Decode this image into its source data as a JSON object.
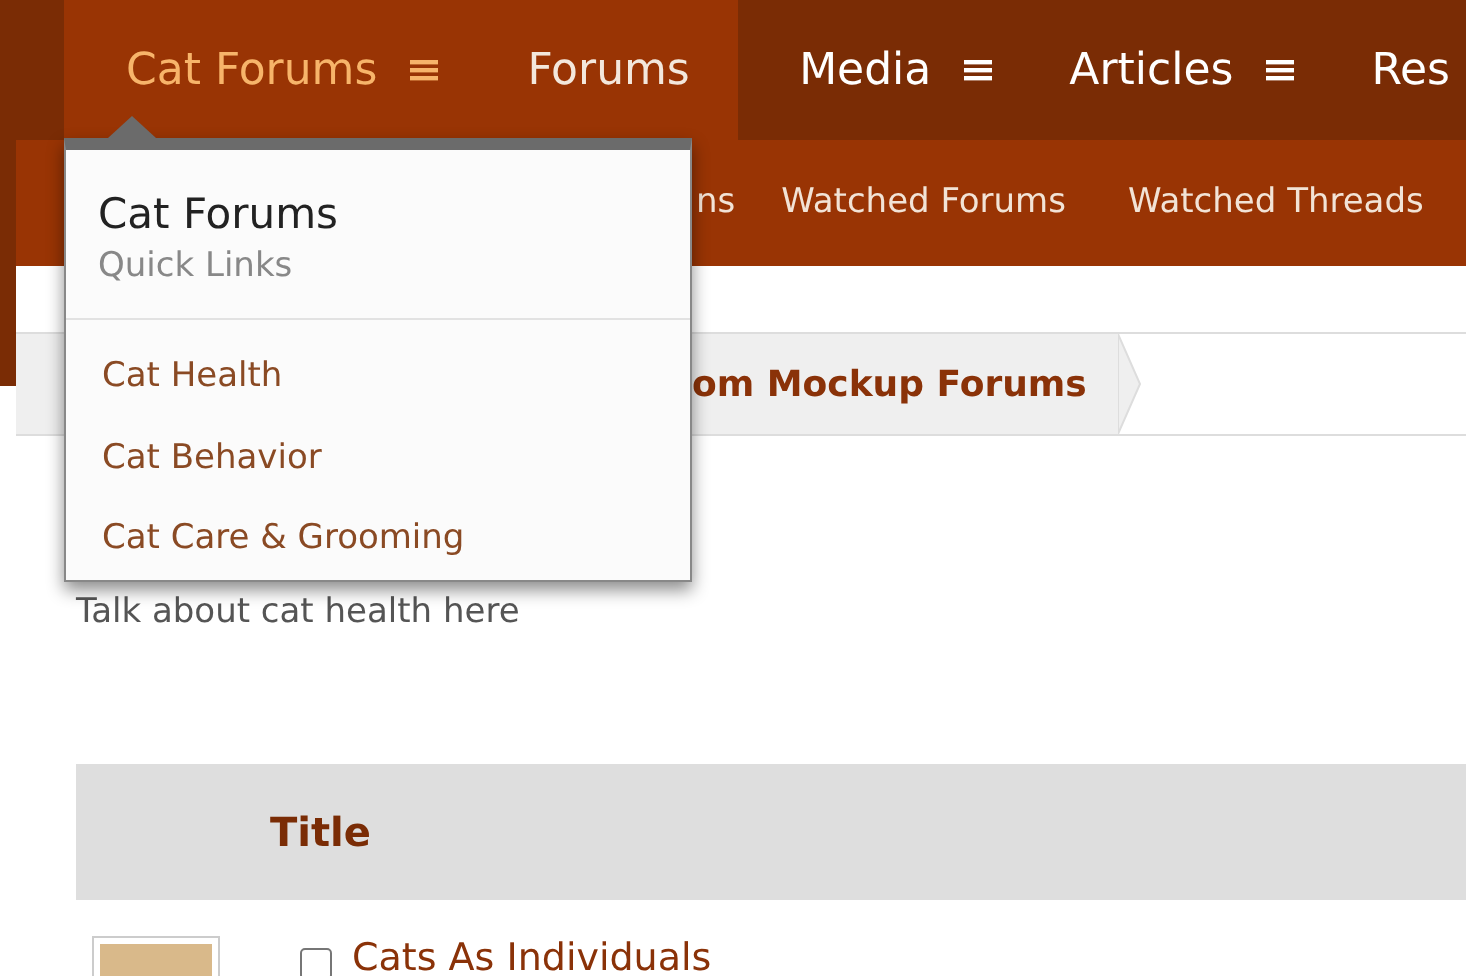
{
  "nav": {
    "tabs": [
      {
        "label": "Cat Forums",
        "selected": true,
        "has_menu": true
      },
      {
        "label": "Forums",
        "selected": false,
        "has_menu": false
      },
      {
        "label": "Media",
        "selected": false,
        "has_menu": true
      },
      {
        "label": "Articles",
        "selected": false,
        "has_menu": true
      },
      {
        "label": "Res",
        "selected": false,
        "has_menu": false
      }
    ]
  },
  "subnav": {
    "items": [
      "ns",
      "Watched Forums",
      "Watched Threads"
    ]
  },
  "dropdown": {
    "title": "Cat Forums",
    "subtitle": "Quick Links",
    "links": [
      "Cat Health",
      "Cat Behavior",
      "Cat Care & Grooming"
    ]
  },
  "breadcrumb": {
    "items": [
      "om Mockup Forums"
    ]
  },
  "description": "Talk about cat health here",
  "table": {
    "columns": [
      "Title"
    ],
    "rows": [
      {
        "title": "Cats As Individuals",
        "checked": false
      }
    ]
  }
}
